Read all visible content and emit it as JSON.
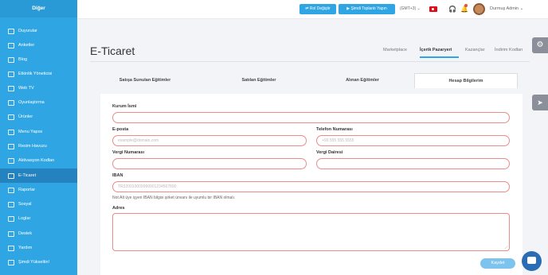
{
  "sidebar": {
    "title": "Diğer",
    "items": [
      {
        "label": "Duyurular"
      },
      {
        "label": "Anketler"
      },
      {
        "label": "Blog"
      },
      {
        "label": "Etkinlik Yöneticisi"
      },
      {
        "label": "Web TV"
      },
      {
        "label": "Oyunlaştırma"
      },
      {
        "label": "Ürünler"
      },
      {
        "label": "Menu Yapısı"
      },
      {
        "label": "Resim Havuzu"
      },
      {
        "label": "Aktivasyon Kodları"
      },
      {
        "label": "E-Ticaret"
      },
      {
        "label": "Raporlar"
      },
      {
        "label": "Sosyal"
      },
      {
        "label": "Loglar"
      },
      {
        "label": "Destek"
      },
      {
        "label": "Yardım"
      },
      {
        "label": "Şimdi Yükseltin!"
      }
    ],
    "active_item": "E-Ticaret"
  },
  "header": {
    "role_button": "Rol Değiştir",
    "meeting_button": "Şimdi Toplantı Yapın",
    "timezone": "(GMT+3)",
    "user_name": "Durmuş Admin"
  },
  "page": {
    "title": "E-Ticaret",
    "top_tabs": [
      "Marketplace",
      "İçerik Pazaryeri",
      "Kazançlar",
      "İndirim Kodları"
    ],
    "active_top_tab": "İçerik Pazaryeri",
    "tabs": [
      "Satışa Sunulan Eğitimler",
      "Satılan Eğitimler",
      "Alınan Eğitimler",
      "Hesap Bilgilerim"
    ],
    "active_tab": "Hesap Bilgilerim"
  },
  "form": {
    "company_name": {
      "label": "Kurum İsmi",
      "value": "",
      "placeholder": ""
    },
    "email": {
      "label": "E-posta",
      "value": "",
      "placeholder": "example@domain.com"
    },
    "phone": {
      "label": "Telefon Numarası",
      "value": "",
      "placeholder": "+90 555 555 5555"
    },
    "tax_number": {
      "label": "Vergi Numarası",
      "value": "",
      "placeholder": ""
    },
    "tax_office": {
      "label": "Vergi Dairesi",
      "value": "",
      "placeholder": ""
    },
    "iban": {
      "label": "IBAN",
      "value": "",
      "placeholder": "TR320010009999901234567890"
    },
    "note": "Not:Alt üye işyeri IBAN bilgisi şirket ünvanı ile uyumlu bir IBAN olmalı.",
    "address": {
      "label": "Adres",
      "value": ""
    },
    "save_button": "Kaydet"
  },
  "colors": {
    "sidebar": "#2fa6e3",
    "active_item": "#2482bf",
    "accent": "#2fa6e3",
    "invalid_border": "#e88c8c"
  }
}
